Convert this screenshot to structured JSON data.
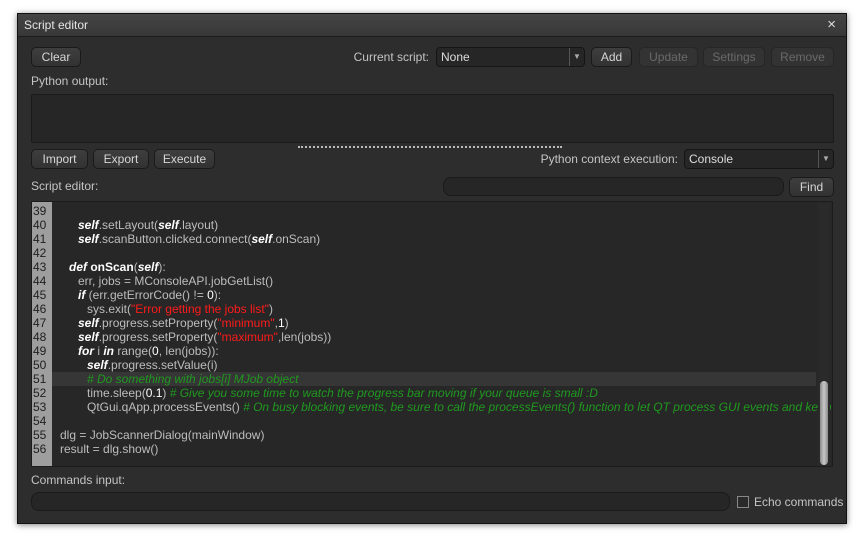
{
  "window": {
    "title": "Script editor",
    "close_icon": "×"
  },
  "toolbar": {
    "clear": "Clear",
    "current_script_label": "Current script:",
    "current_script_value": "None",
    "add": "Add",
    "update": "Update",
    "settings": "Settings",
    "remove": "Remove"
  },
  "output": {
    "label": "Python output:"
  },
  "actions": {
    "import": "Import",
    "export": "Export",
    "execute": "Execute",
    "context_label": "Python context execution:",
    "context_value": "Console"
  },
  "editor": {
    "label": "Script editor:",
    "search_value": "",
    "find": "Find",
    "lines": [
      {
        "n": "39",
        "indent": 0,
        "tokens": []
      },
      {
        "n": "40",
        "indent": 2,
        "tokens": [
          [
            "kw",
            "self"
          ],
          [
            "",
            ".setLayout("
          ],
          [
            "kw",
            "self"
          ],
          [
            "",
            ".layout)"
          ]
        ]
      },
      {
        "n": "41",
        "indent": 2,
        "tokens": [
          [
            "kw",
            "self"
          ],
          [
            "",
            ".scanButton.clicked.connect("
          ],
          [
            "kw",
            "self"
          ],
          [
            "",
            ".onScan)"
          ]
        ]
      },
      {
        "n": "42",
        "indent": 0,
        "tokens": []
      },
      {
        "n": "43",
        "indent": 1,
        "tokens": [
          [
            "kw",
            "def"
          ],
          [
            "fn",
            " onScan"
          ],
          [
            "",
            "("
          ],
          [
            "kw",
            "self"
          ],
          [
            "",
            "):"
          ]
        ]
      },
      {
        "n": "44",
        "indent": 2,
        "tokens": [
          [
            "",
            "err, jobs = MConsoleAPI.jobGetList()"
          ]
        ]
      },
      {
        "n": "45",
        "indent": 2,
        "tokens": [
          [
            "kw",
            "if"
          ],
          [
            "",
            " (err.getErrorCode() != "
          ],
          [
            "num",
            "0"
          ],
          [
            "",
            "):"
          ]
        ]
      },
      {
        "n": "46",
        "indent": 3,
        "tokens": [
          [
            "",
            "sys.exit("
          ],
          [
            "str",
            "\"Error getting the jobs list\""
          ],
          [
            "",
            ")"
          ]
        ]
      },
      {
        "n": "47",
        "indent": 2,
        "tokens": [
          [
            "kw",
            "self"
          ],
          [
            "",
            ".progress.setProperty("
          ],
          [
            "str",
            "\"minimum\""
          ],
          [
            "",
            ","
          ],
          [
            "num",
            "1"
          ],
          [
            "",
            ")"
          ]
        ]
      },
      {
        "n": "48",
        "indent": 2,
        "tokens": [
          [
            "kw",
            "self"
          ],
          [
            "",
            ".progress.setProperty("
          ],
          [
            "str",
            "\"maximum\""
          ],
          [
            "",
            ",len(jobs))"
          ]
        ]
      },
      {
        "n": "49",
        "indent": 2,
        "tokens": [
          [
            "kw",
            "for"
          ],
          [
            "",
            " i "
          ],
          [
            "kw",
            "in"
          ],
          [
            "",
            " range("
          ],
          [
            "num",
            "0"
          ],
          [
            "",
            ", len(jobs)):"
          ]
        ]
      },
      {
        "n": "50",
        "indent": 3,
        "tokens": [
          [
            "kw",
            "self"
          ],
          [
            "",
            ".progress.setValue(i)"
          ]
        ]
      },
      {
        "n": "51",
        "indent": 3,
        "highlight": true,
        "tokens": [
          [
            "cm",
            "# Do something with jobs[i] MJob object"
          ]
        ]
      },
      {
        "n": "52",
        "indent": 3,
        "tokens": [
          [
            "",
            "time.sleep("
          ],
          [
            "num",
            "0.1"
          ],
          [
            "",
            ") "
          ],
          [
            "cm",
            "# Give you some time to watch the progress bar moving if your queue is small :D"
          ]
        ]
      },
      {
        "n": "53",
        "indent": 3,
        "tokens": [
          [
            "",
            "QtGui.qApp.processEvents() "
          ],
          [
            "cm",
            "# On busy blocking events, be sure to call the processEvents() function to let QT process GUI events and keep the interface interactive"
          ]
        ]
      },
      {
        "n": "54",
        "indent": 0,
        "tokens": []
      },
      {
        "n": "55",
        "indent": 0,
        "tokens": [
          [
            "",
            "dlg = JobScannerDialog(mainWindow)"
          ]
        ]
      },
      {
        "n": "56",
        "indent": 0,
        "tokens": [
          [
            "",
            "result = dlg.show()"
          ]
        ]
      }
    ]
  },
  "commands": {
    "label": "Commands input:",
    "value": "",
    "echo_label": "Echo commands",
    "echo_checked": false
  }
}
